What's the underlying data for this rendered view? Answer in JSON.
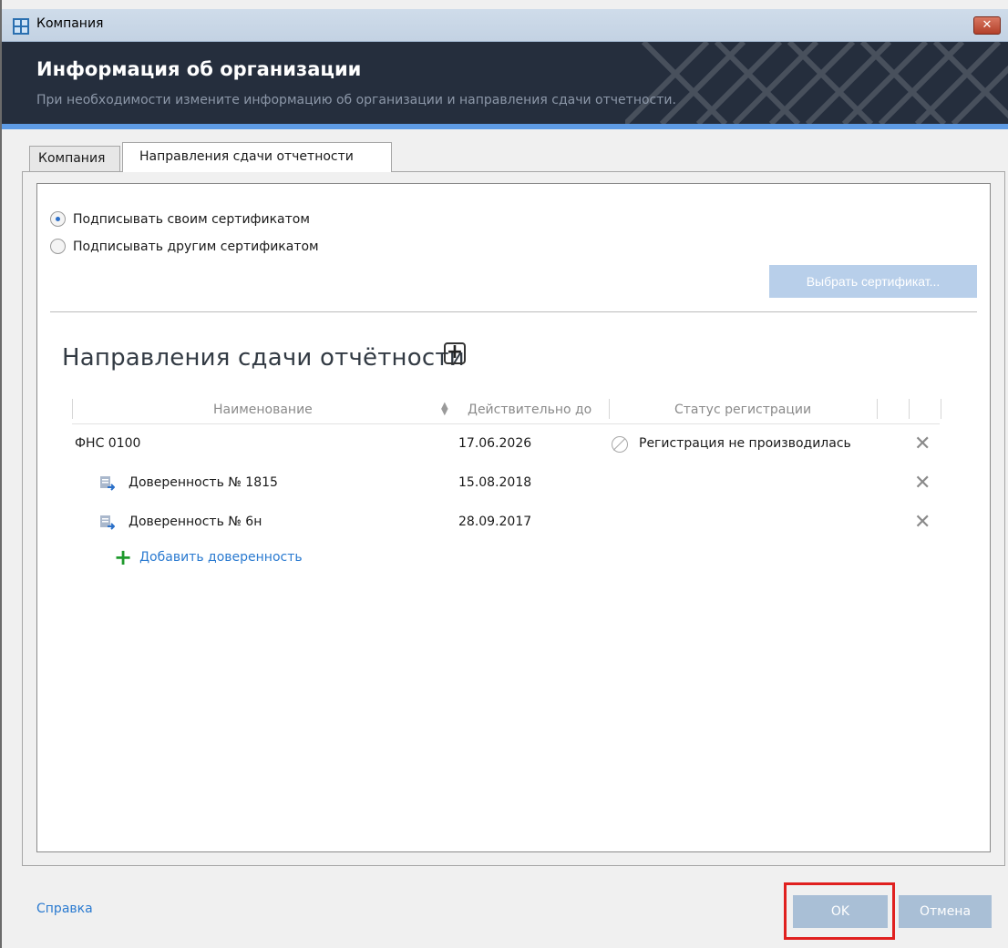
{
  "window": {
    "title": "Компания",
    "close_label": "✕"
  },
  "header": {
    "title": "Информация об организации",
    "subtitle": "При необходимости измените информацию об организации и направления сдачи отчетности."
  },
  "tabs": [
    {
      "label": "Компания",
      "active": false
    },
    {
      "label": "Направления сдачи отчетности",
      "active": true
    }
  ],
  "signing": {
    "own_cert_label": "Подписывать своим сертификатом",
    "other_cert_label": "Подписывать другим сертификатом",
    "selected": "own",
    "choose_cert_button": "Выбрать сертификат..."
  },
  "directions": {
    "title": "Направления сдачи отчётности",
    "add_symbol": "+",
    "columns": [
      "Наименование",
      "Действительно до",
      "Статус регистрации"
    ],
    "rows": [
      {
        "name": "ФНС 0100",
        "valid_until": "17.06.2026",
        "status": "Регистрация не производилась",
        "delete": "✕"
      },
      {
        "name": "Доверенность № 1815",
        "valid_until": "15.08.2018",
        "status": "",
        "delete": "✕"
      },
      {
        "name": "Доверенность № 6н",
        "valid_until": "28.09.2017",
        "status": "",
        "delete": "✕"
      }
    ],
    "add_proxy_symbol": "+",
    "add_proxy_label": "Добавить доверенность"
  },
  "footer": {
    "help": "Справка",
    "ok": "OK",
    "cancel": "Отмена"
  },
  "colors": {
    "header_bg": "#252e3d",
    "accent": "#5e9be4",
    "button_bg": "#a9bfd6",
    "highlight": "#e0201f",
    "link": "#2a7ad0"
  }
}
